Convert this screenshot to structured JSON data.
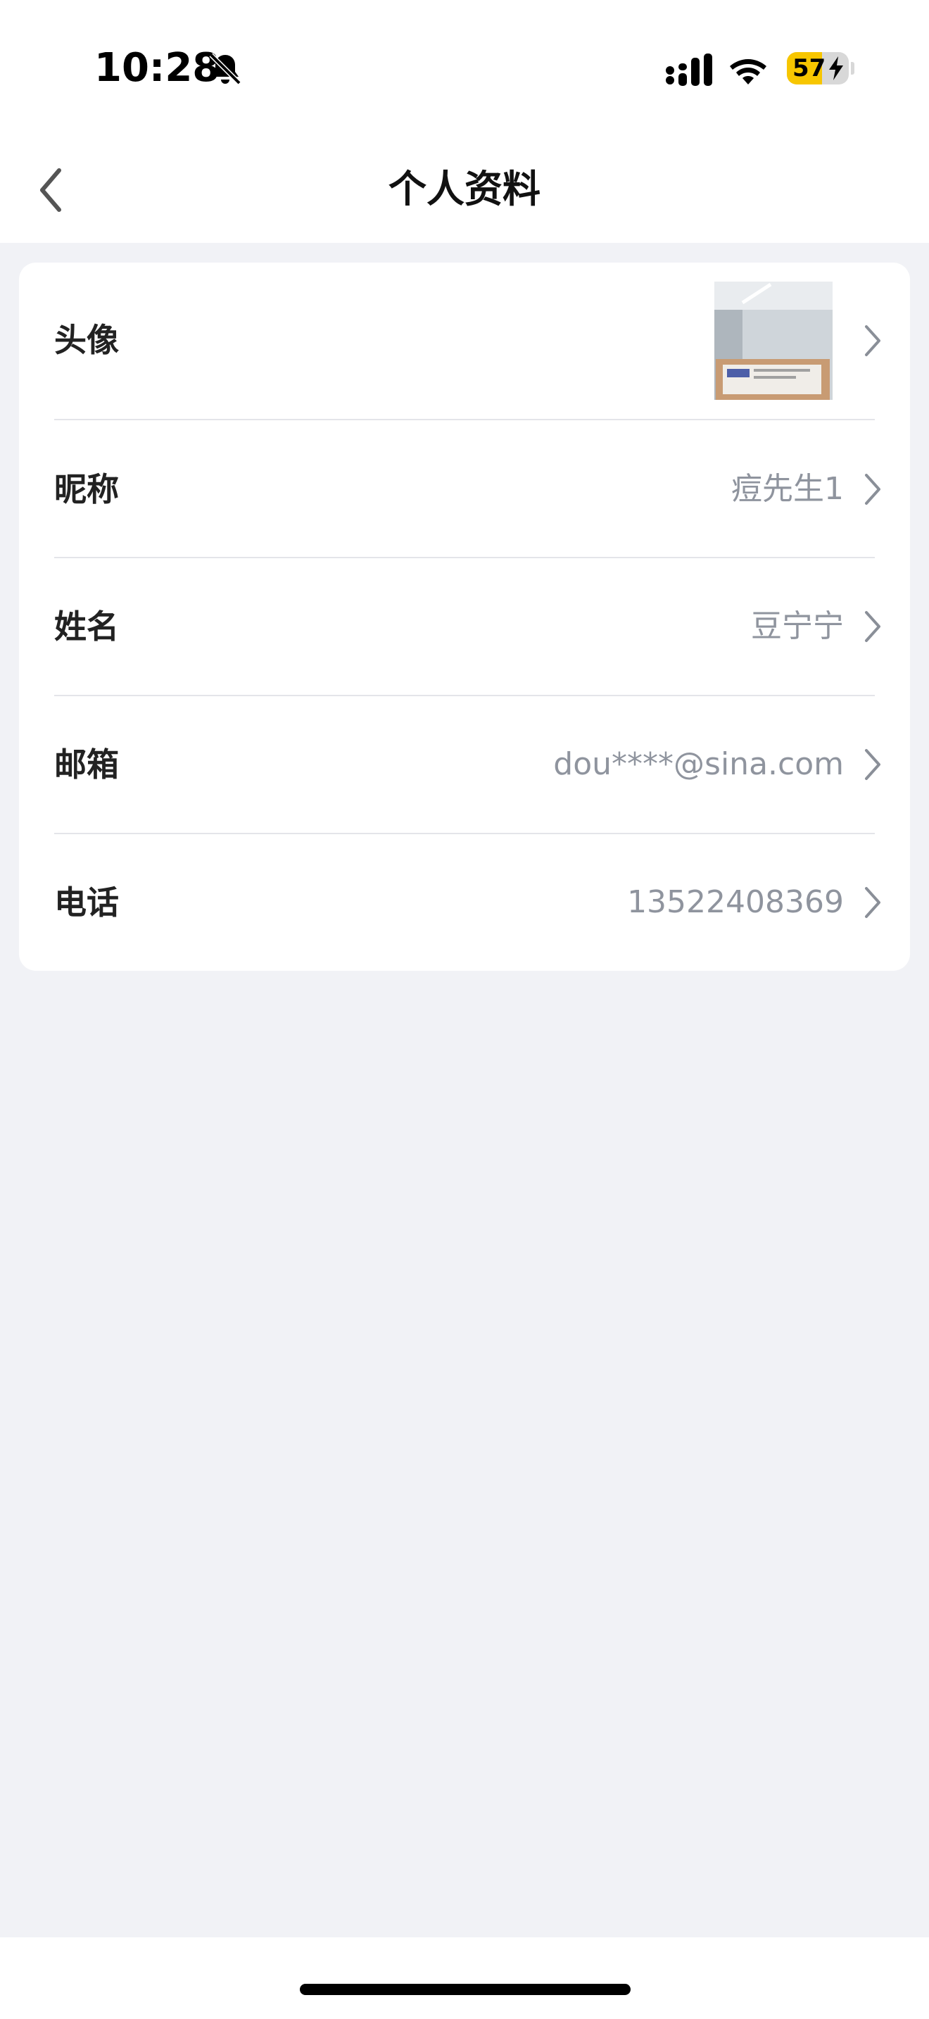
{
  "status_bar": {
    "time": "10:28",
    "battery_percent": "57",
    "battery_level": 0.57,
    "icons": [
      "bell-slash-icon",
      "signal-icon",
      "wifi-icon",
      "battery-charging-icon"
    ]
  },
  "nav": {
    "title": "个人资料",
    "back_icon": "chevron-left-icon"
  },
  "profile": {
    "avatar": {
      "label": "头像"
    },
    "nickname": {
      "label": "昵称",
      "value": "痘先生1"
    },
    "name": {
      "label": "姓名",
      "value": "豆宁宁"
    },
    "email": {
      "label": "邮箱",
      "value": "dou****@sina.com"
    },
    "phone": {
      "label": "电话",
      "value": "13522408369"
    }
  },
  "colors": {
    "background": "#f1f2f6",
    "card": "#ffffff",
    "value_text": "#8f949e",
    "battery_accent": "#f7c600"
  }
}
